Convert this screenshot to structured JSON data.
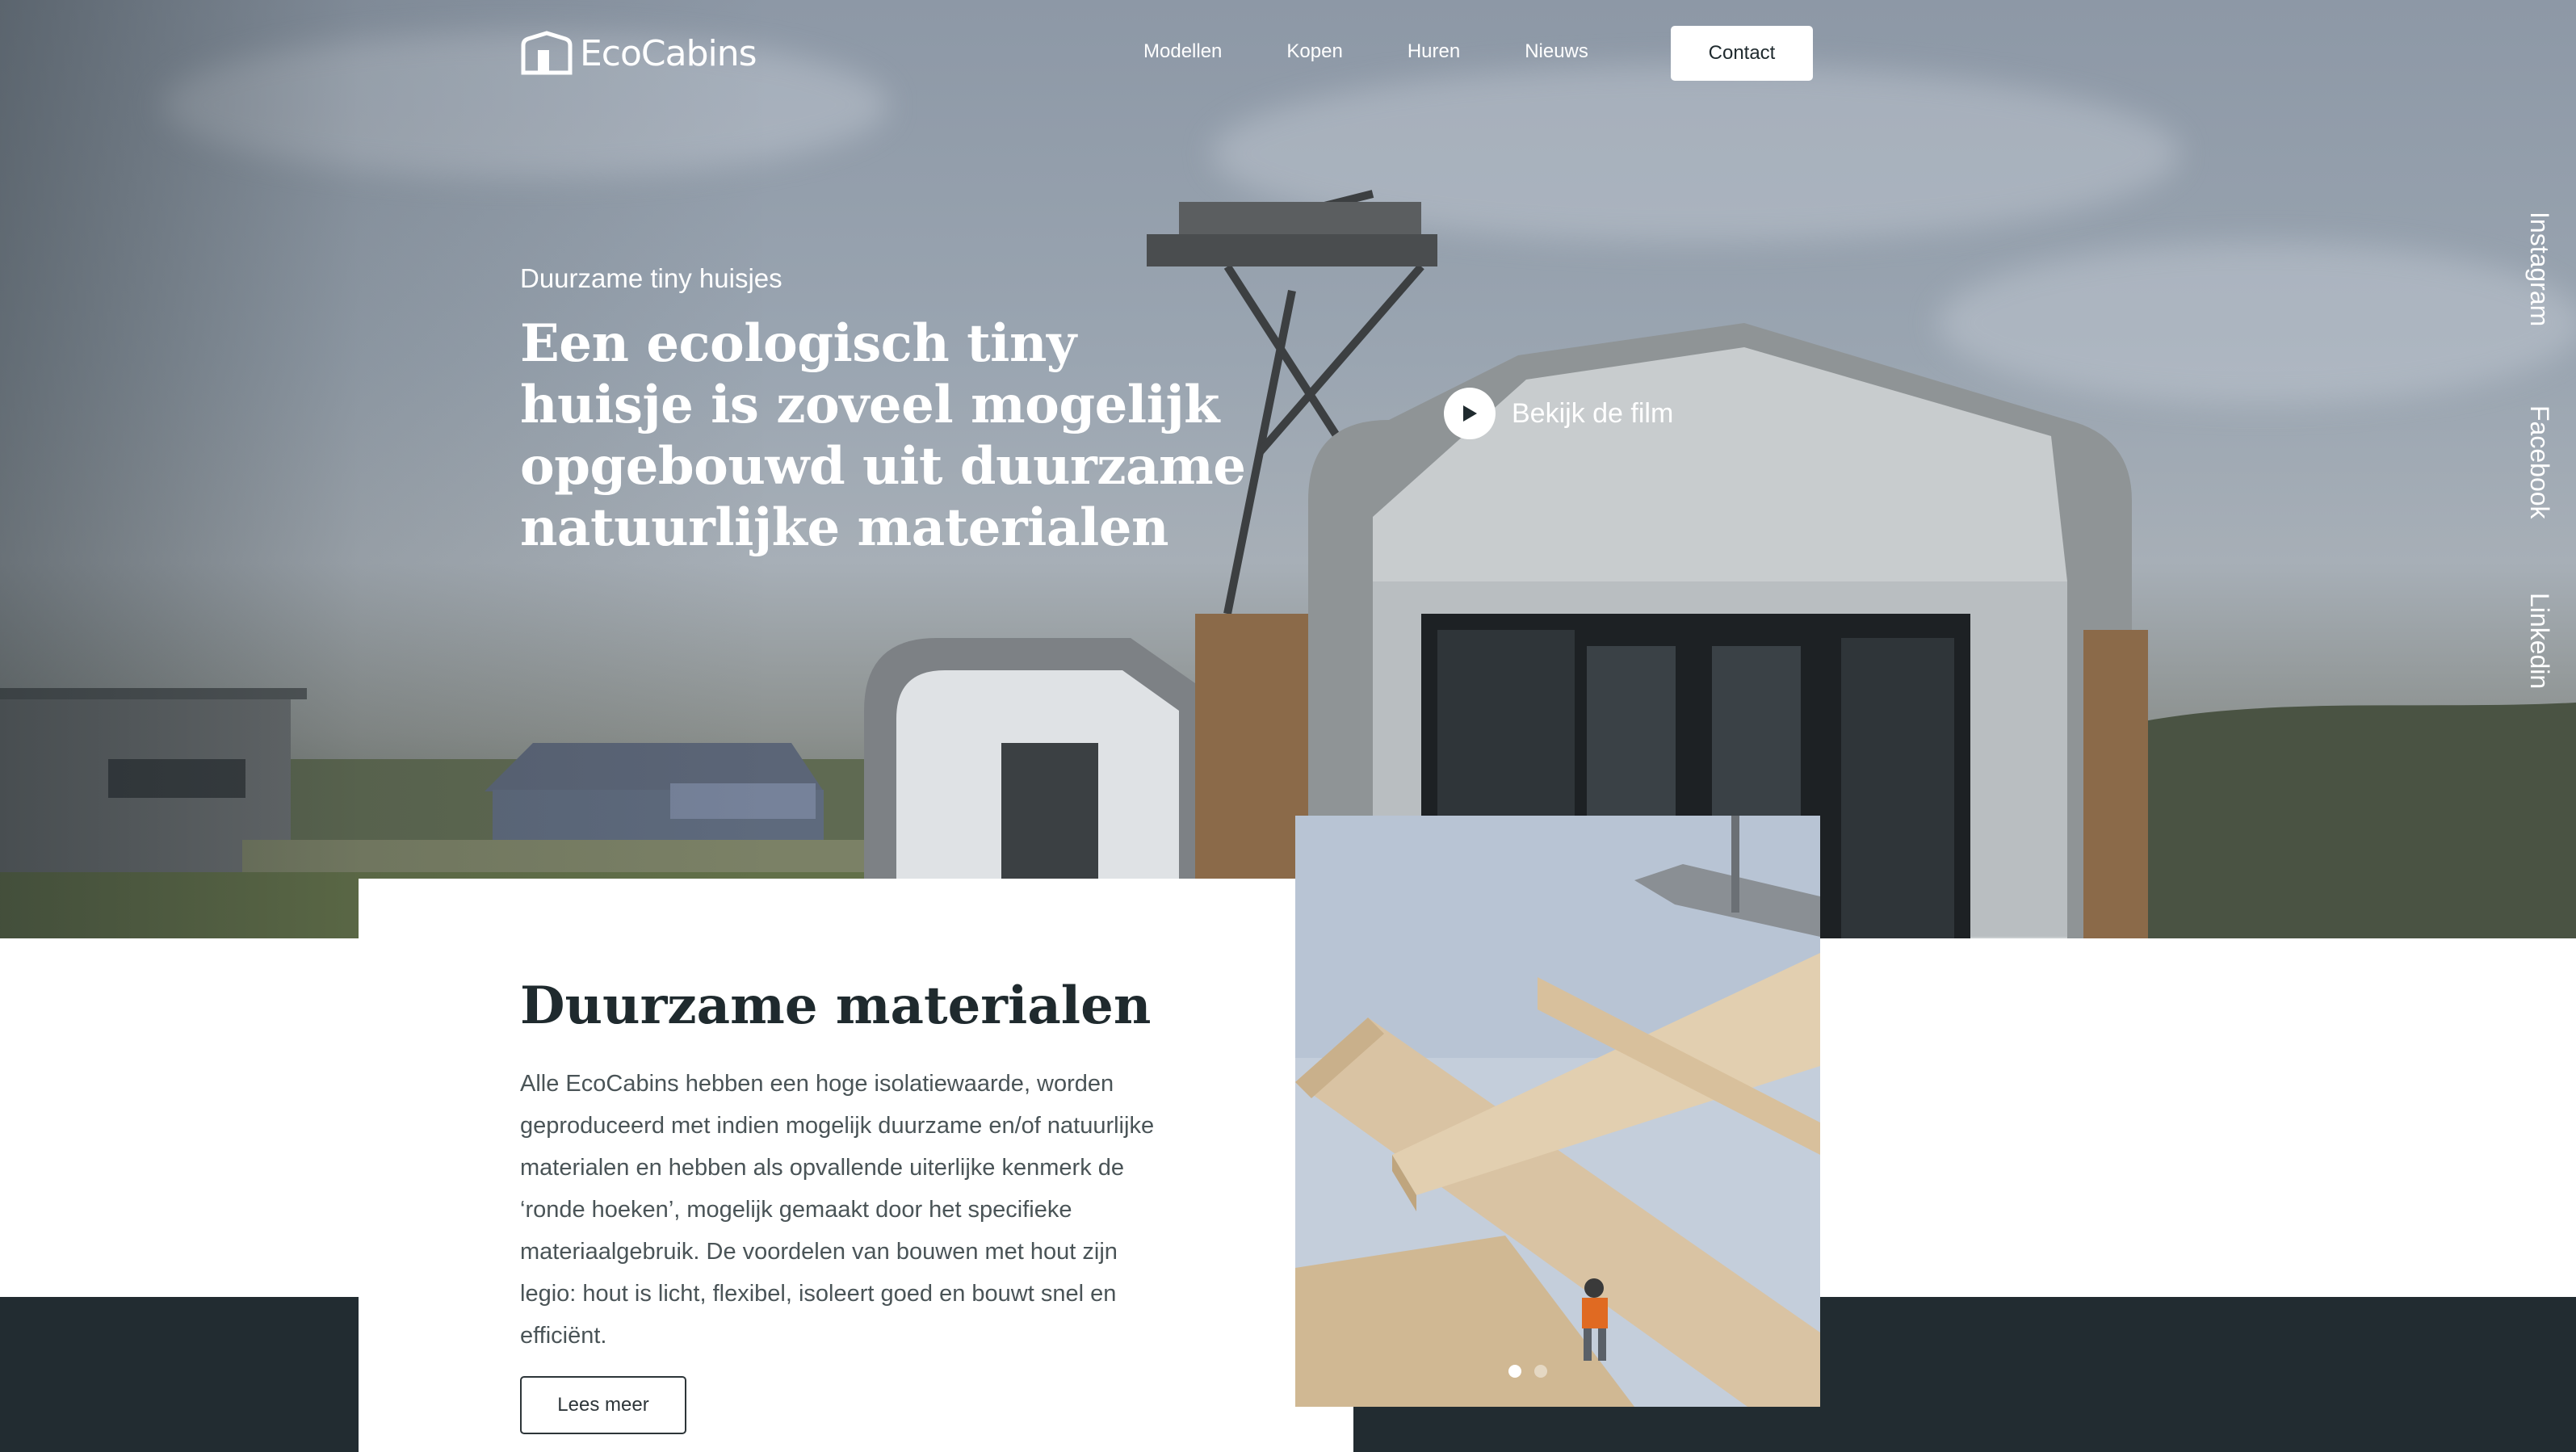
{
  "brand": {
    "name": "EcoCabins"
  },
  "nav": {
    "items": [
      "Modellen",
      "Kopen",
      "Huren",
      "Nieuws"
    ],
    "contact_label": "Contact"
  },
  "hero": {
    "eyebrow": "Duurzame tiny huisjes",
    "headline": "Een ecologisch tiny huisje is zoveel mogelijk opgebouwd uit duurzame natuurlijke materialen",
    "film_label": "Bekijk de film"
  },
  "social": [
    "Instagram",
    "Facebook",
    "Linkedin"
  ],
  "section": {
    "title": "Duurzame materialen",
    "body": "Alle EcoCabins hebben een hoge isolatiewaarde, worden geproduceerd met indien mogelijk duurzame en/of natuurlijke materialen en hebben als opvallende uiterlijke kenmerk de ‘ronde hoeken’, mogelijk gemaakt door het specifieke materiaalgebruik. De voordelen van bouwen met hout zijn legio: hout is licht, flexibel, isoleert goed en bouwt snel en efficiënt.",
    "more_label": "Lees meer"
  },
  "carousel": {
    "slides": 2,
    "active": 1
  },
  "colors": {
    "dark_band": "#222c31",
    "text_dark": "#1f2a2e",
    "white": "#ffffff"
  }
}
